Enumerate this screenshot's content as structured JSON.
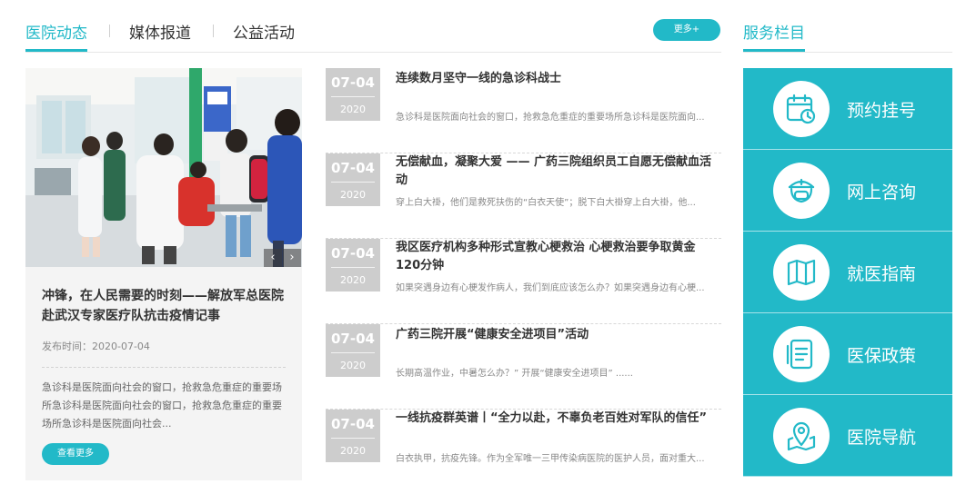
{
  "tabs": {
    "items": [
      {
        "label": "医院动态",
        "active": true
      },
      {
        "label": "媒体报道",
        "active": false
      },
      {
        "label": "公益活动",
        "active": false
      }
    ],
    "more_label": "更多+"
  },
  "feature": {
    "title": "冲锋，在人民需要的时刻——解放军总医院赴武汉专家医疗队抗击疫情记事",
    "date": "发布时间：2020-07-04",
    "description": "急诊科是医院面向社会的窗口，抢救急危重症的重要场所急诊科是医院面向社会的窗口，抢救急危重症的重要场所急诊科是医院面向社会...",
    "button_label": "查看更多"
  },
  "news": [
    {
      "md": "07-04",
      "year": "2020",
      "title": "连续数月坚守一线的急诊科战士",
      "desc": "急诊科是医院面向社会的窗口，抢救急危重症的重要场所急诊科是医院面向..."
    },
    {
      "md": "07-04",
      "year": "2020",
      "title": "无偿献血，凝聚大爱 —— 广药三院组织员工自愿无偿献血活动",
      "desc": "穿上白大褂，他们是救死扶伤的“白衣天使”；脱下白大褂穿上白大褂，他..."
    },
    {
      "md": "07-04",
      "year": "2020",
      "title": "我区医疗机构多种形式宣教心梗救治 心梗救治要争取黄金120分钟",
      "desc": "如果突遇身边有心梗发作病人，我们到底应该怎么办？如果突遇身边有心梗..."
    },
    {
      "md": "07-04",
      "year": "2020",
      "title": "广药三院开展“健康安全进项目”活动",
      "desc": "长期高温作业，中暑怎么办？” 开展“健康安全进项目” ......"
    },
    {
      "md": "07-04",
      "year": "2020",
      "title": "一线抗疫群英谱丨“全力以赴，不辜负老百姓对军队的信任”",
      "desc": "白衣执甲，抗疫先锋。作为全军唯一三甲传染病医院的医护人员，面对重大..."
    }
  ],
  "services": {
    "title": "服务栏目",
    "items": [
      {
        "label": "预约挂号",
        "icon": "calendar-clock-icon"
      },
      {
        "label": "网上咨询",
        "icon": "doctor-icon"
      },
      {
        "label": "就医指南",
        "icon": "map-guide-icon"
      },
      {
        "label": "医保政策",
        "icon": "document-list-icon"
      },
      {
        "label": "医院导航",
        "icon": "location-map-icon"
      }
    ]
  },
  "colors": {
    "accent": "#22b9c8",
    "date_box": "#cdcdcd",
    "card_bg": "#f4f4f4"
  }
}
